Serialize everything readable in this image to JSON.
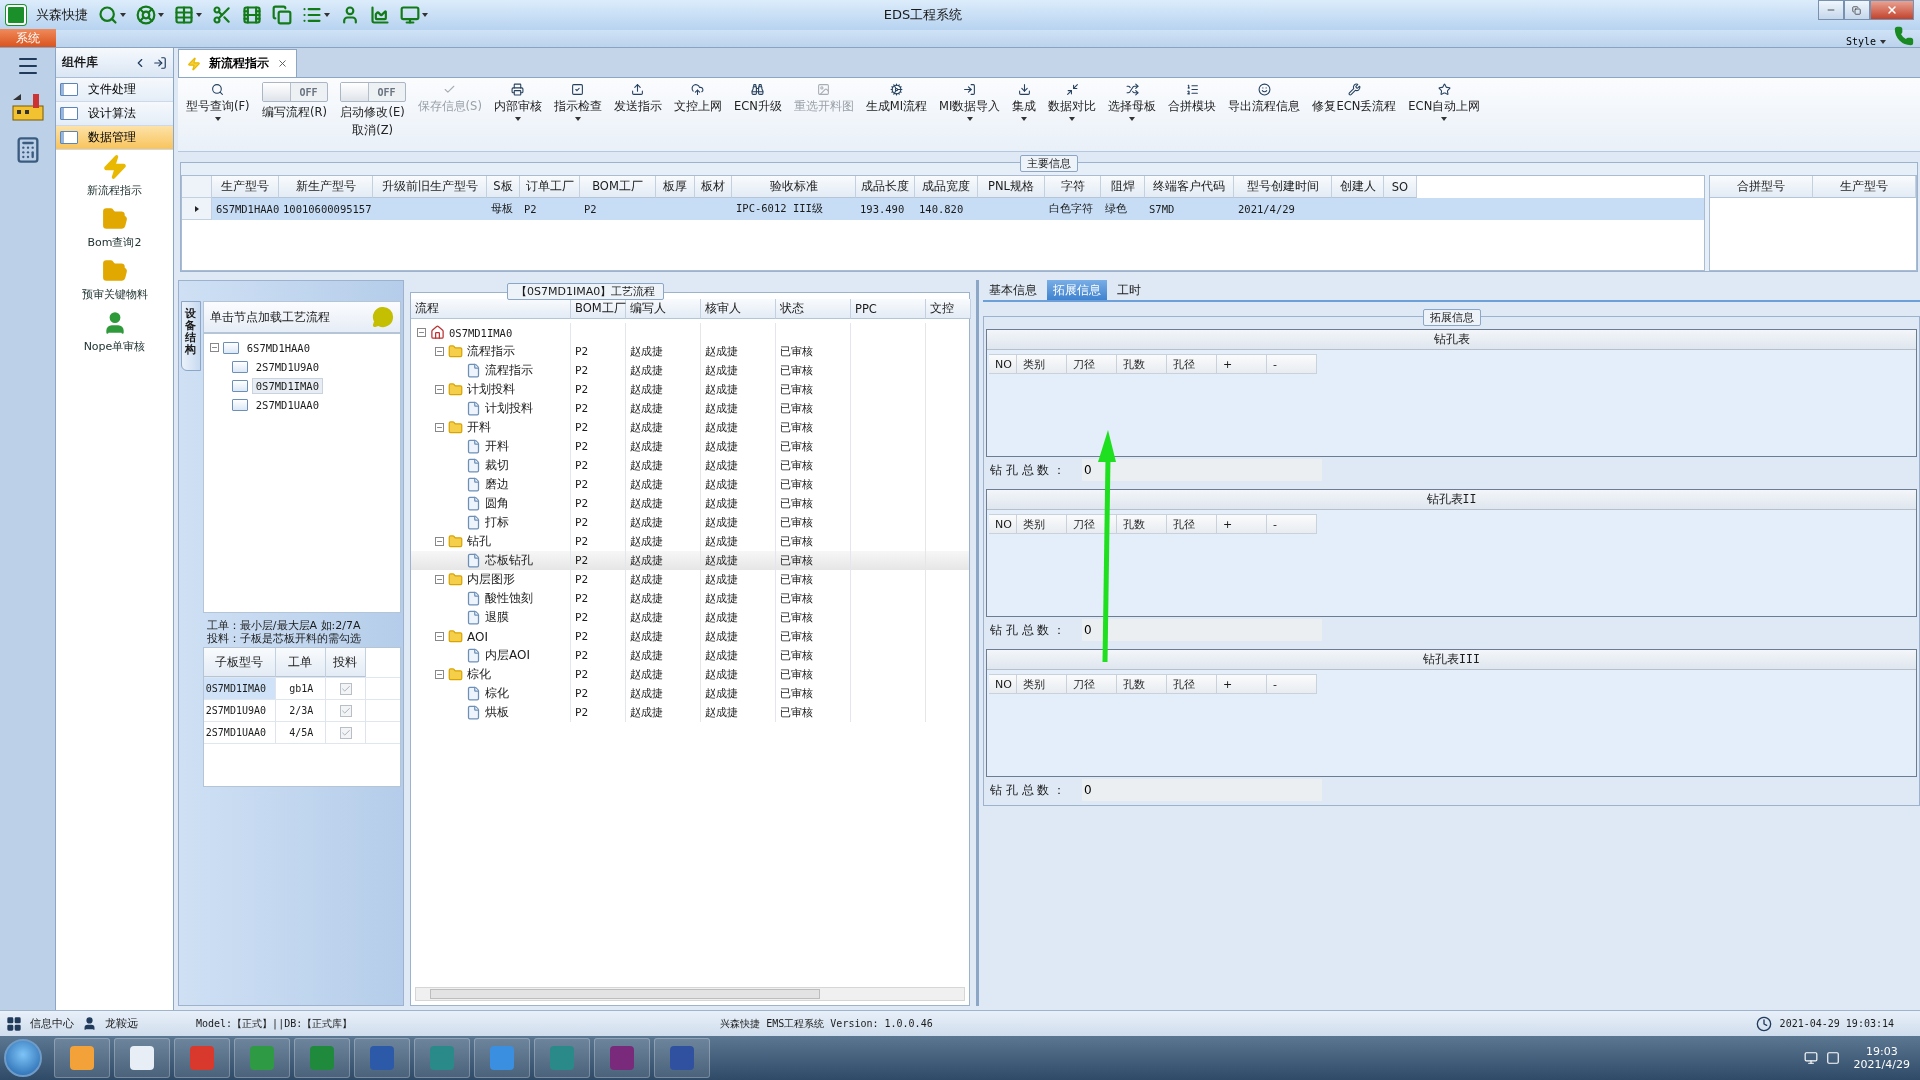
{
  "window": {
    "app_name": "兴森快捷",
    "title": "EDS工程系统",
    "style_menu": "Style"
  },
  "ribbon_tabs": [
    {
      "label": "系统",
      "selected": true
    }
  ],
  "component_library": {
    "title": "组件库",
    "items": [
      {
        "label": "文件处理",
        "selected": false
      },
      {
        "label": "设计算法",
        "selected": false
      },
      {
        "label": "数据管理",
        "selected": true
      }
    ],
    "tools": [
      {
        "label": "新流程指示"
      },
      {
        "label": "Bom查询2"
      },
      {
        "label": "预审关键物料"
      },
      {
        "label": "Nope单审核"
      }
    ]
  },
  "doc_tabs": [
    {
      "label": "新流程指示",
      "selected": true
    }
  ],
  "toolbar": [
    {
      "kind": "button",
      "label": "型号查询(F)",
      "disabled": false,
      "dropdown": true
    },
    {
      "kind": "toggle",
      "label": "编写流程(R)",
      "on": false,
      "state_text": "OFF"
    },
    {
      "kind": "toggle",
      "label": "启动修改(E)",
      "sublabel": "取消(Z)",
      "on": false,
      "state_text": "OFF"
    },
    {
      "kind": "button",
      "label": "保存信息(S)",
      "disabled": true,
      "dropdown": false
    },
    {
      "kind": "button",
      "label": "内部审核",
      "disabled": false,
      "dropdown": true
    },
    {
      "kind": "button",
      "label": "指示检查",
      "disabled": false,
      "dropdown": true
    },
    {
      "kind": "button",
      "label": "发送指示",
      "disabled": false,
      "dropdown": false
    },
    {
      "kind": "button",
      "label": "文控上网",
      "disabled": false,
      "dropdown": false
    },
    {
      "kind": "button",
      "label": "ECN升级",
      "disabled": false,
      "dropdown": false
    },
    {
      "kind": "button",
      "label": "重选开料图",
      "disabled": true,
      "dropdown": false
    },
    {
      "kind": "button",
      "label": "生成MI流程",
      "disabled": false,
      "dropdown": false
    },
    {
      "kind": "button",
      "label": "MI数据导入",
      "disabled": false,
      "dropdown": true
    },
    {
      "kind": "button",
      "label": "集成",
      "disabled": false,
      "dropdown": true
    },
    {
      "kind": "button",
      "label": "数据对比",
      "disabled": false,
      "dropdown": true
    },
    {
      "kind": "button",
      "label": "选择母板",
      "disabled": false,
      "dropdown": true
    },
    {
      "kind": "button",
      "label": "合拼模块",
      "disabled": false,
      "dropdown": false
    },
    {
      "kind": "button",
      "label": "导出流程信息",
      "disabled": false,
      "dropdown": false
    },
    {
      "kind": "button",
      "label": "修复ECN丢流程",
      "disabled": false,
      "dropdown": false
    },
    {
      "kind": "button",
      "label": "ECN自动上网",
      "disabled": false,
      "dropdown": true
    }
  ],
  "main_info": {
    "title": "主要信息",
    "columns": [
      "生产型号",
      "新生产型号",
      "升级前旧生产型号",
      "S板",
      "订单工厂",
      "BOM工厂",
      "板厚",
      "板材",
      "验收标准",
      "成品长度",
      "成品宽度",
      "PNL规格",
      "字符",
      "阻焊",
      "终端客户代码",
      "型号创建时间",
      "创建人",
      "SO"
    ],
    "rows": [
      {
        "selected": true,
        "cells": [
          "6S7MD1HAA0",
          "10010600095157",
          "",
          "母板",
          "P2",
          "P2",
          "",
          "",
          "IPC-6012 III级",
          "193.490",
          "140.820",
          "",
          "白色字符",
          "绿色",
          "S7MD",
          "2021/4/29",
          "",
          ""
        ]
      }
    ],
    "side_columns": [
      "合拼型号",
      "生产型号"
    ]
  },
  "structure_panel": {
    "tab": "设备结构",
    "hint": "单击节点加载工艺流程",
    "tree": [
      {
        "label": "6S7MD1HAA0",
        "expanded": true,
        "selected": false,
        "children": [
          {
            "label": "2S7MD1U9A0",
            "selected": false
          },
          {
            "label": "0S7MD1IMA0",
            "selected": true
          },
          {
            "label": "2S7MD1UAA0",
            "selected": false
          }
        ]
      }
    ],
    "note_lines": [
      "工单：最小层/最大层A 如:2/7A",
      "投料：子板是芯板开料的需勾选"
    ],
    "columns": [
      "子板型号",
      "工单",
      "投料"
    ],
    "rows": [
      {
        "model": "0S7MD1IMA0",
        "order": "gb1A",
        "feed": true,
        "selected": true
      },
      {
        "model": "2S7MD1U9A0",
        "order": "2/3A",
        "feed": true,
        "selected": false
      },
      {
        "model": "2S7MD1UAA0",
        "order": "4/5A",
        "feed": true,
        "selected": false
      }
    ]
  },
  "flow": {
    "title": "【0S7MD1IMA0】工艺流程",
    "columns": [
      "流程",
      "BOM工厂",
      "编写人",
      "核审人",
      "状态",
      "PPC",
      "文控"
    ],
    "tree": [
      {
        "label": "0S7MD1IMA0",
        "kind": "root",
        "expanded": true,
        "selected": false,
        "children": [
          {
            "label": "流程指示",
            "kind": "folder",
            "expanded": true,
            "selected": false,
            "cells": [
              "P2",
              "赵成捷",
              "赵成捷",
              "已审核"
            ],
            "children": [
              {
                "label": "流程指示",
                "kind": "step",
                "selected": false,
                "cells": [
                  "P2",
                  "赵成捷",
                  "赵成捷",
                  "已审核"
                ]
              }
            ]
          },
          {
            "label": "计划投料",
            "kind": "folder",
            "expanded": true,
            "selected": false,
            "cells": [
              "P2",
              "赵成捷",
              "赵成捷",
              "已审核"
            ],
            "children": [
              {
                "label": "计划投料",
                "kind": "step",
                "selected": false,
                "cells": [
                  "P2",
                  "赵成捷",
                  "赵成捷",
                  "已审核"
                ]
              }
            ]
          },
          {
            "label": "开料",
            "kind": "folder",
            "expanded": true,
            "selected": false,
            "cells": [
              "P2",
              "赵成捷",
              "赵成捷",
              "已审核"
            ],
            "children": [
              {
                "label": "开料",
                "kind": "step",
                "selected": false,
                "cells": [
                  "P2",
                  "赵成捷",
                  "赵成捷",
                  "已审核"
                ]
              },
              {
                "label": "裁切",
                "kind": "step",
                "selected": false,
                "cells": [
                  "P2",
                  "赵成捷",
                  "赵成捷",
                  "已审核"
                ]
              },
              {
                "label": "磨边",
                "kind": "step",
                "selected": false,
                "cells": [
                  "P2",
                  "赵成捷",
                  "赵成捷",
                  "已审核"
                ]
              },
              {
                "label": "圆角",
                "kind": "step",
                "selected": false,
                "cells": [
                  "P2",
                  "赵成捷",
                  "赵成捷",
                  "已审核"
                ]
              },
              {
                "label": "打标",
                "kind": "step",
                "selected": false,
                "cells": [
                  "P2",
                  "赵成捷",
                  "赵成捷",
                  "已审核"
                ]
              }
            ]
          },
          {
            "label": "钻孔",
            "kind": "folder",
            "expanded": true,
            "selected": false,
            "cells": [
              "P2",
              "赵成捷",
              "赵成捷",
              "已审核"
            ],
            "children": [
              {
                "label": "芯板钻孔",
                "kind": "step",
                "selected": true,
                "cells": [
                  "P2",
                  "赵成捷",
                  "赵成捷",
                  "已审核"
                ]
              }
            ]
          },
          {
            "label": "内层图形",
            "kind": "folder",
            "expanded": true,
            "selected": false,
            "cells": [
              "P2",
              "赵成捷",
              "赵成捷",
              "已审核"
            ],
            "children": [
              {
                "label": "酸性蚀刻",
                "kind": "step",
                "selected": false,
                "cells": [
                  "P2",
                  "赵成捷",
                  "赵成捷",
                  "已审核"
                ]
              },
              {
                "label": "退膜",
                "kind": "step",
                "selected": false,
                "cells": [
                  "P2",
                  "赵成捷",
                  "赵成捷",
                  "已审核"
                ]
              }
            ]
          },
          {
            "label": "AOI",
            "kind": "folder",
            "expanded": true,
            "selected": false,
            "cells": [
              "P2",
              "赵成捷",
              "赵成捷",
              "已审核"
            ],
            "children": [
              {
                "label": "内层AOI",
                "kind": "step",
                "selected": false,
                "cells": [
                  "P2",
                  "赵成捷",
                  "赵成捷",
                  "已审核"
                ]
              }
            ]
          },
          {
            "label": "棕化",
            "kind": "folder",
            "expanded": true,
            "selected": false,
            "cells": [
              "P2",
              "赵成捷",
              "赵成捷",
              "已审核"
            ],
            "children": [
              {
                "label": "棕化",
                "kind": "step",
                "selected": false,
                "cells": [
                  "P2",
                  "赵成捷",
                  "赵成捷",
                  "已审核"
                ]
              },
              {
                "label": "烘板",
                "kind": "step",
                "selected": false,
                "cells": [
                  "P2",
                  "赵成捷",
                  "赵成捷",
                  "已审核"
                ]
              }
            ]
          }
        ]
      }
    ]
  },
  "detail_tabs": [
    {
      "label": "基本信息",
      "selected": false
    },
    {
      "label": "拓展信息",
      "selected": true
    },
    {
      "label": "工时",
      "selected": false
    }
  ],
  "extended": {
    "title": "拓展信息",
    "drill_tables": [
      {
        "title": "钻孔表",
        "columns": [
          "NO",
          "类别",
          "刀径",
          "孔数",
          "孔径",
          "+",
          "-"
        ],
        "total_label": "钻 孔 总 数 ：",
        "total": "0"
      },
      {
        "title": "钻孔表II",
        "columns": [
          "NO",
          "类别",
          "刀径",
          "孔数",
          "孔径",
          "+",
          "-"
        ],
        "total_label": "钻 孔 总 数 ：",
        "total": "0"
      },
      {
        "title": "钻孔表III",
        "columns": [
          "NO",
          "类别",
          "刀径",
          "孔数",
          "孔径",
          "+",
          "-"
        ],
        "total_label": "钻 孔 总 数 ：",
        "total": "0"
      }
    ]
  },
  "status_bar": {
    "info_center": "信息中心",
    "user": "龙鞍远",
    "model": "Model:【正式】||DB:【正式库】",
    "center": "兴森快捷 EMS工程系统 Version: 1.0.0.46",
    "datetime": "2021-04-29 19:03:14"
  },
  "taskbar": {
    "time": "19:03",
    "date": "2021/4/29"
  }
}
